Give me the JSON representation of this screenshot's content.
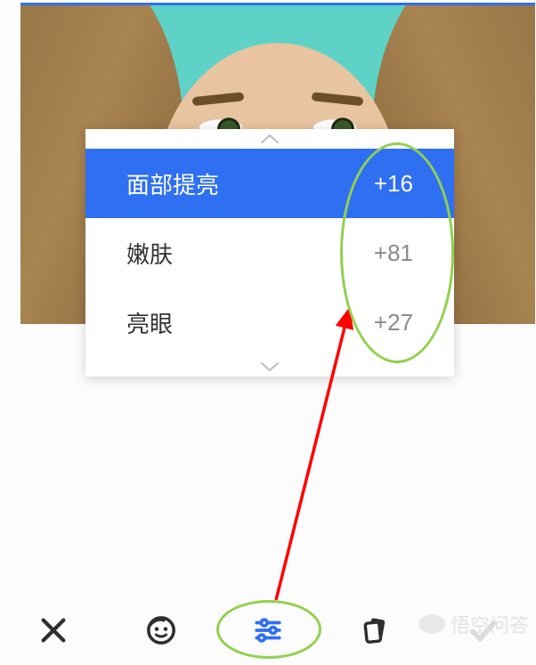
{
  "panel": {
    "rows": [
      {
        "label": "面部提亮",
        "value": "+16",
        "active": true
      },
      {
        "label": "嫩肤",
        "value": "+81",
        "active": false
      },
      {
        "label": "亮眼",
        "value": "+27",
        "active": false
      }
    ]
  },
  "bottombar": {
    "close": "close",
    "face": "face",
    "tune": "tune",
    "style": "style",
    "apply": "apply"
  },
  "watermark": {
    "text": "悟空问答"
  }
}
